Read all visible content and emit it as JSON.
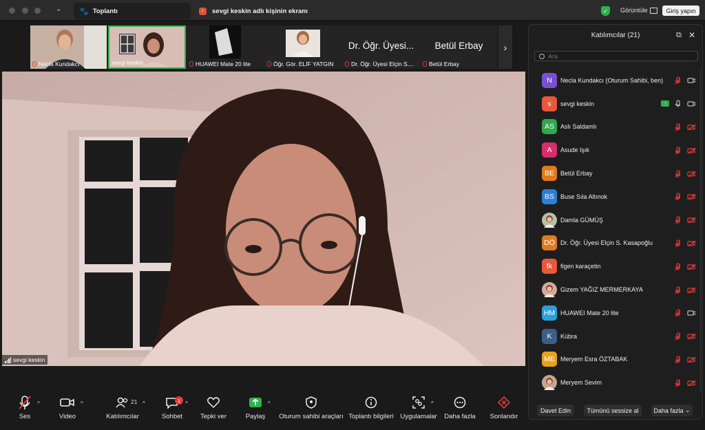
{
  "window": {
    "tab_title": "Toplantı",
    "share_tab": "sevgi keskin adlı kişinin ekranı",
    "view_label": "Görüntüle",
    "signin_label": "Giriş yapın"
  },
  "thumbnails": [
    {
      "name": "Necla Kundakcı",
      "muted": true,
      "kind": "video"
    },
    {
      "name": "sevgi keskin",
      "muted": false,
      "kind": "video",
      "active": true
    },
    {
      "name": "HUAWEI Mate 20 lite",
      "muted": true,
      "kind": "video"
    },
    {
      "name": "Öğr. Gör. ELİF YATGIN",
      "muted": true,
      "kind": "photo"
    },
    {
      "name": "Dr. Öğr. Üyesi Elçin S....",
      "muted": true,
      "kind": "text",
      "big_text": "Dr. Öğr. Üyesi..."
    },
    {
      "name": "Betül Erbay",
      "muted": true,
      "kind": "text",
      "big_text": "Betül Erbay"
    }
  ],
  "main_video": {
    "speaker_name": "sevgi keskin"
  },
  "toolbar": {
    "audio": "Ses",
    "video": "Video",
    "participants": "Katılımcılar",
    "participants_count": "21",
    "chat": "Sohbet",
    "chat_badge": "1",
    "reactions": "Tepki ver",
    "share": "Paylaş",
    "host_tools": "Oturum sahibi araçları",
    "meeting_info": "Toplantı bilgileri",
    "apps": "Uygulamalar",
    "more": "Daha fazla",
    "end": "Sonlandır"
  },
  "panel": {
    "title": "Katılımcılar (21)",
    "search_placeholder": "Ara",
    "participants": [
      {
        "initials": "N",
        "name": "Necla Kundakcı (Oturum Sahibi, ben)",
        "color": "#7a4fd1",
        "mic": "muted",
        "cam": "on",
        "photo": false
      },
      {
        "initials": "s",
        "name": "sevgi keskin",
        "color": "#e8583a",
        "mic": "on",
        "cam": "on",
        "photo": false,
        "sharing": true
      },
      {
        "initials": "AS",
        "name": "Aslı Saldamlı",
        "color": "#2fa84f",
        "mic": "muted",
        "cam": "off",
        "photo": false
      },
      {
        "initials": "A",
        "name": "Asude Işık",
        "color": "#d62e6d",
        "mic": "muted",
        "cam": "off",
        "photo": false
      },
      {
        "initials": "BE",
        "name": "Betül Erbay",
        "color": "#e07a1e",
        "mic": "muted",
        "cam": "off",
        "photo": false
      },
      {
        "initials": "BS",
        "name": "Buse Sıla Altınok",
        "color": "#2b7fd9",
        "mic": "muted",
        "cam": "off",
        "photo": false
      },
      {
        "initials": "",
        "name": "Damla GÜMÜŞ",
        "color": "#b8c1a0",
        "mic": "muted",
        "cam": "off",
        "photo": true
      },
      {
        "initials": "DÖ",
        "name": "Dr. Öğr. Üyesi Elçin S. Kasapoğlu",
        "color": "#e07a1e",
        "mic": "muted",
        "cam": "off",
        "photo": false
      },
      {
        "initials": "fk",
        "name": "figen karaçetin",
        "color": "#e8583a",
        "mic": "muted",
        "cam": "off",
        "photo": false
      },
      {
        "initials": "",
        "name": "Gizem YAĞIZ MERMERKAYA",
        "color": "#d8a89a",
        "mic": "muted",
        "cam": "off",
        "photo": true
      },
      {
        "initials": "HM",
        "name": "HUAWEI Mate 20 lite",
        "color": "#2b9fd9",
        "mic": "muted",
        "cam": "on",
        "photo": false
      },
      {
        "initials": "K",
        "name": "Kübra",
        "color": "#3b5f8a",
        "mic": "muted",
        "cam": "off",
        "photo": false
      },
      {
        "initials": "ME",
        "name": "Meryem Esra ÖZTABAK",
        "color": "#e8a21e",
        "mic": "muted",
        "cam": "off",
        "photo": false
      },
      {
        "initials": "",
        "name": "Meryem Sevim",
        "color": "#c9a48f",
        "mic": "muted",
        "cam": "off",
        "photo": true
      }
    ],
    "invite": "Davet Edin",
    "mute_all": "Tümünü sessize al",
    "more": "Daha fazla"
  }
}
